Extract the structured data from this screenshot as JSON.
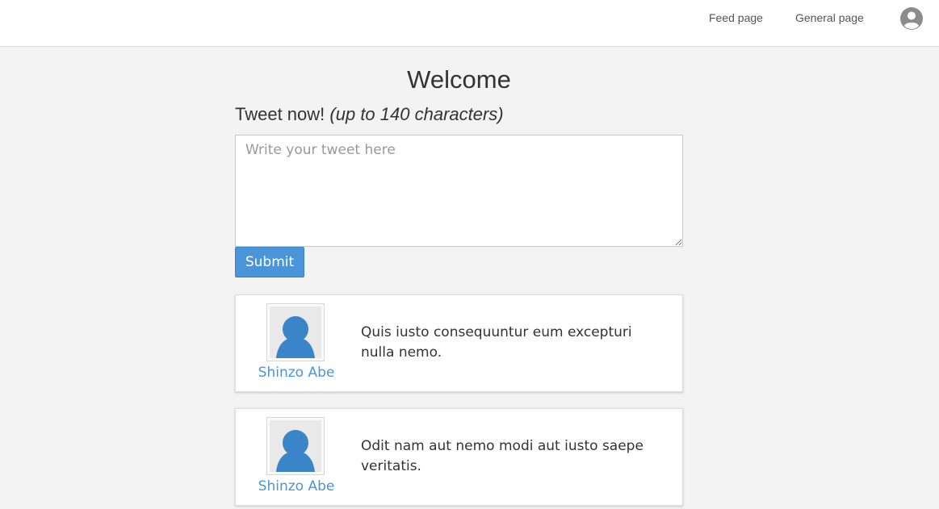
{
  "nav": {
    "feed_label": "Feed page",
    "general_label": "General page"
  },
  "main": {
    "title": "Welcome",
    "tweet_heading": "Tweet now!",
    "tweet_heading_note": "(up to 140 characters)",
    "tweet_placeholder": "Write your tweet here",
    "tweet_value": "",
    "submit_label": "Submit"
  },
  "tweets": [
    {
      "author": "Shinzo Abe",
      "text": "Quis iusto consequuntur eum excepturi nulla nemo.",
      "avatar_icon": "user-silhouette-icon"
    },
    {
      "author": "Shinzo Abe",
      "text": "Odit nam aut nemo modi aut iusto saepe veritatis.",
      "avatar_icon": "user-silhouette-icon"
    }
  ],
  "colors": {
    "accent": "#4a95d9",
    "background": "#f3f3f3",
    "navbar": "#ffffff"
  }
}
